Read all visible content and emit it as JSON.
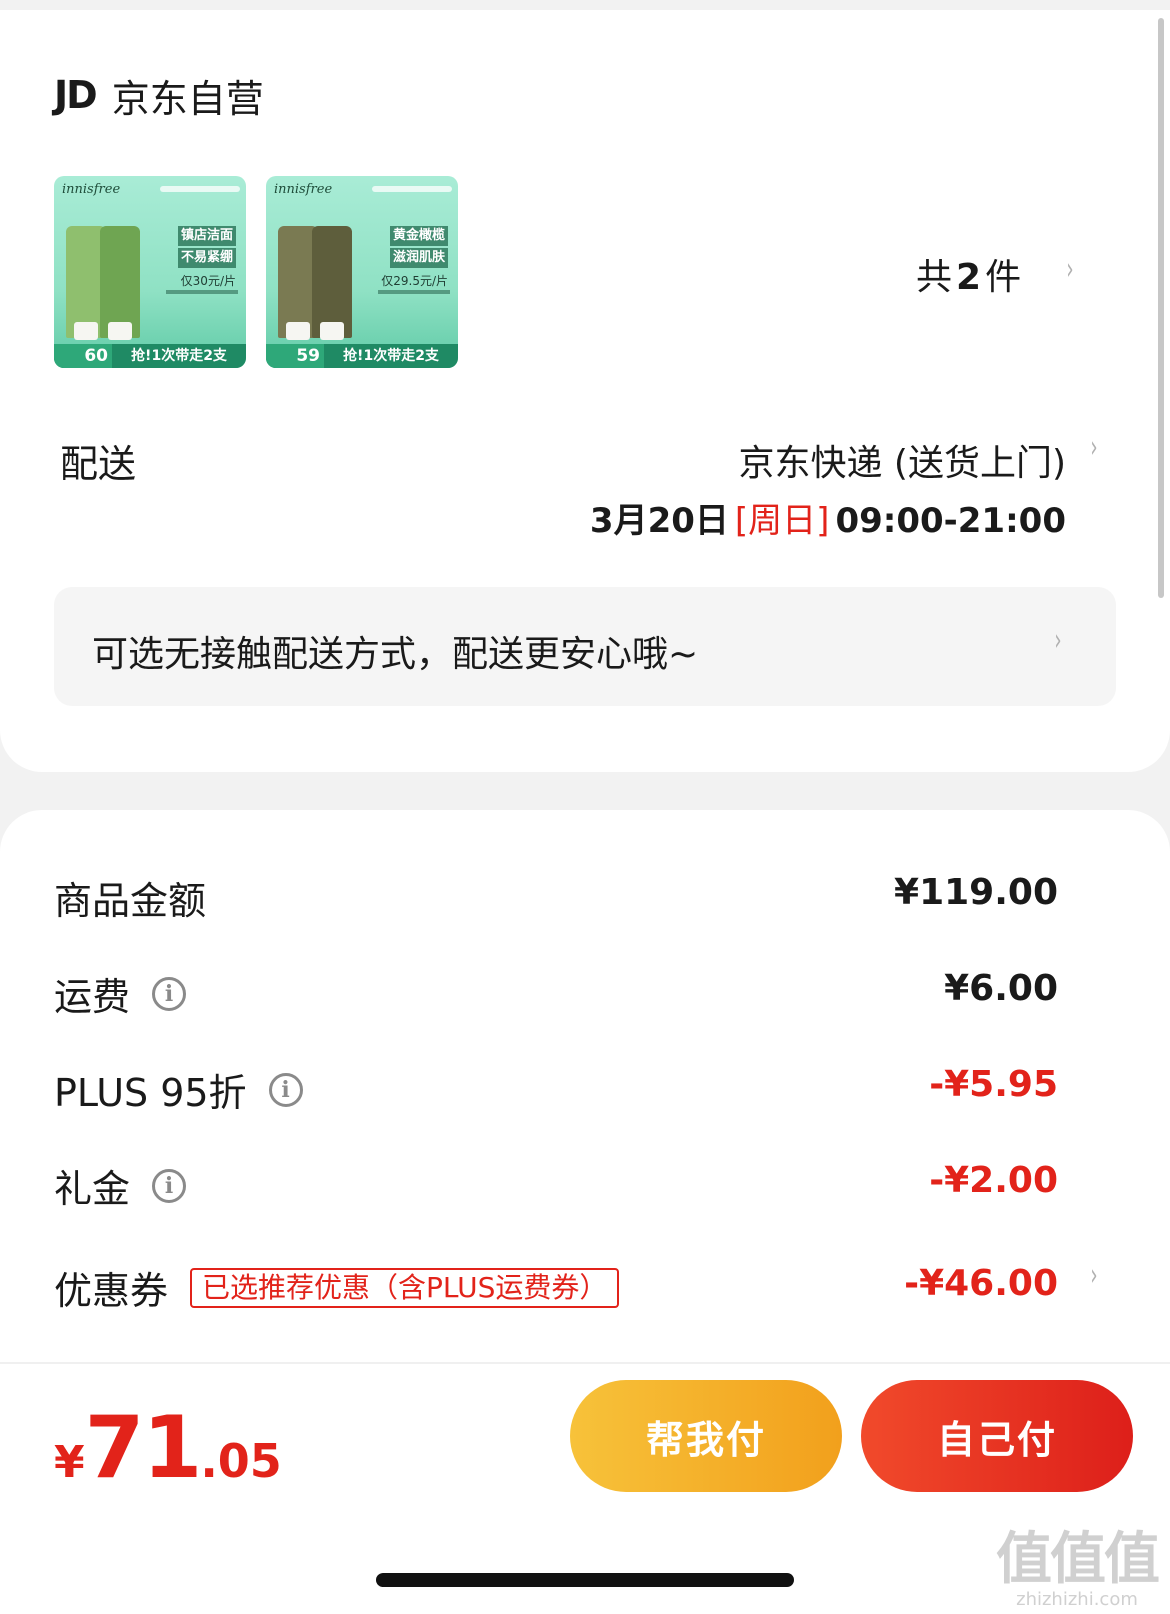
{
  "shop": {
    "logo": "JD",
    "name": "京东自营"
  },
  "products": [
    {
      "brand": "innisfree",
      "headline_1": "镇店洁面",
      "headline_2": "不易紧绷",
      "price_line": "仅30元/片",
      "price": "60",
      "promo": "抢!1次带走2支",
      "color": "#8fbf6e",
      "color_dark": "#6fa552"
    },
    {
      "brand": "innisfree",
      "headline_1": "黄金橄榄",
      "headline_2": "滋润肌肤",
      "price_line": "仅29.5元/片",
      "price": "59",
      "promo": "抢!1次带走2支",
      "color": "#7a7a52",
      "color_dark": "#5e5e3c"
    }
  ],
  "item_count": {
    "prefix": "共",
    "count": "2",
    "suffix": "件"
  },
  "delivery": {
    "label": "配送",
    "method": "京东快递 (送货上门)",
    "date": "3月20日",
    "weekday": "[周日]",
    "time_window": "09:00-21:00"
  },
  "notice": {
    "text": "可选无接触配送方式，配送更安心哦~"
  },
  "price_rows": {
    "goods": {
      "label": "商品金额",
      "amount": "¥119.00"
    },
    "shipping": {
      "label": "运费",
      "amount": "¥6.00"
    },
    "plus": {
      "label": "PLUS 95折",
      "amount": "-¥5.95"
    },
    "gift": {
      "label": "礼金",
      "amount": "-¥2.00"
    },
    "coupon": {
      "label": "优惠券",
      "tag": "已选推荐优惠（含PLUS运费券）",
      "amount": "-¥46.00"
    }
  },
  "total": {
    "currency": "¥",
    "integer": "71",
    "decimal": ".05"
  },
  "buttons": {
    "help_pay": "帮我付",
    "self_pay": "自己付"
  },
  "watermark": {
    "big": "值值值",
    "small": "zhizhizhi.com"
  },
  "colors": {
    "accent_red": "#e2231a",
    "help_button": "#f2a01c",
    "pay_button": "#dd1f1a"
  }
}
